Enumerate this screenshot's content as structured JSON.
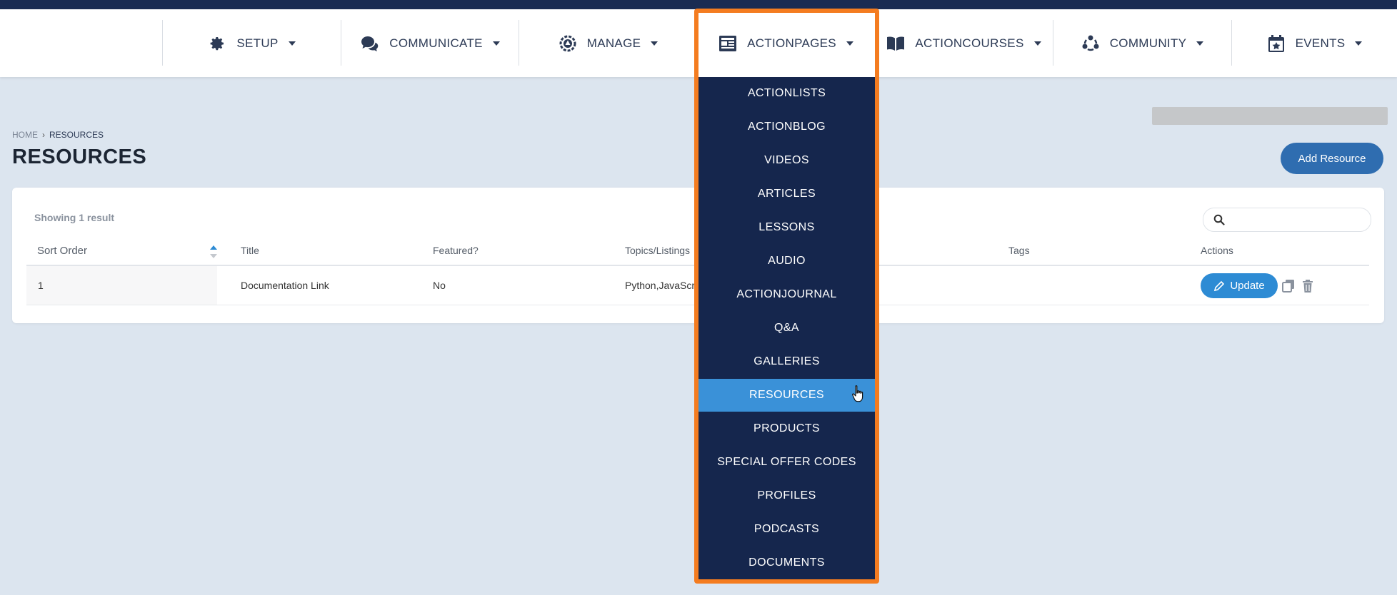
{
  "nav": {
    "items": [
      {
        "label": "SETUP",
        "icon": "gear-icon"
      },
      {
        "label": "COMMUNICATE",
        "icon": "chat-bubbles-icon"
      },
      {
        "label": "MANAGE",
        "icon": "cog-alert-icon"
      },
      {
        "label": "ACTIONPAGES",
        "icon": "newspaper-icon"
      },
      {
        "label": "ACTIONCOURSES",
        "icon": "open-book-icon"
      },
      {
        "label": "COMMUNITY",
        "icon": "community-icon"
      },
      {
        "label": "EVENTS",
        "icon": "calendar-star-icon"
      }
    ]
  },
  "breadcrumb": {
    "home": "HOME",
    "current": "RESOURCES"
  },
  "page": {
    "title": "RESOURCES",
    "add_button": "Add Resource"
  },
  "table": {
    "summary": "Showing 1 result",
    "search_placeholder": "",
    "columns": [
      "Sort Order",
      "Title",
      "Featured?",
      "Topics/Listings",
      "Tags",
      "Actions"
    ],
    "rows": [
      {
        "sort_order": "1",
        "title": "Documentation Link",
        "featured": "No",
        "topics": "Python,JavaScript",
        "tags": ""
      }
    ],
    "update_label": "Update"
  },
  "dropdown": {
    "active_item": "RESOURCES",
    "items": [
      "ACTIONLISTS",
      "ACTIONBLOG",
      "VIDEOS",
      "ARTICLES",
      "LESSONS",
      "AUDIO",
      "ACTIONJOURNAL",
      "Q&A",
      "GALLERIES",
      "RESOURCES",
      "PRODUCTS",
      "SPECIAL OFFER CODES",
      "PROFILES",
      "PODCASTS",
      "DOCUMENTS"
    ]
  },
  "colors": {
    "navy": "#15264d",
    "highlight_border": "#f47c20",
    "active_item": "#3a91d8",
    "primary_button": "#2f6db0",
    "update_button": "#2d8bd4",
    "background": "#dce5ef"
  }
}
